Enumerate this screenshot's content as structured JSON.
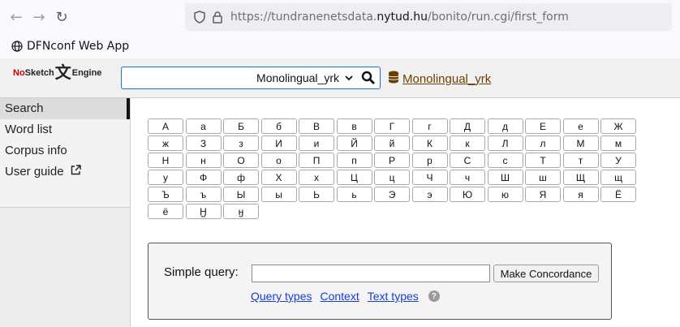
{
  "browser": {
    "url_prefix": "https://tundranenetsdata.",
    "url_host": "nytud.hu",
    "url_suffix": "/bonito/run.cgi/first_form",
    "bookmark": "DFNconf Web App"
  },
  "header": {
    "logo": {
      "no": "No",
      "sketch": "Sketch",
      "glyph": "文",
      "engine": "Engine"
    },
    "corpus_select_value": "Monolingual_yrk",
    "corpus_link": "Monolingual_yrk"
  },
  "sidebar": {
    "items": [
      {
        "label": "Search",
        "active": true
      },
      {
        "label": "Word list"
      },
      {
        "label": "Corpus info"
      },
      {
        "label": "User guide"
      }
    ]
  },
  "keyboard": {
    "keys": [
      "А",
      "а",
      "Б",
      "б",
      "В",
      "в",
      "Г",
      "г",
      "Д",
      "д",
      "Е",
      "е",
      "Ж",
      "ж",
      "З",
      "з",
      "И",
      "и",
      "Й",
      "й",
      "К",
      "к",
      "Л",
      "л",
      "М",
      "м",
      "Н",
      "н",
      "О",
      "о",
      "П",
      "п",
      "Р",
      "р",
      "С",
      "с",
      "Т",
      "т",
      "У",
      "у",
      "Ф",
      "ф",
      "Х",
      "х",
      "Ц",
      "ц",
      "Ч",
      "ч",
      "Ш",
      "ш",
      "Щ",
      "щ",
      "Ъ",
      "ъ",
      "Ы",
      "ы",
      "Ь",
      "ь",
      "Э",
      "э",
      "Ю",
      "ю",
      "Я",
      "я",
      "Ё",
      "ё",
      "Ӈ",
      "ӈ"
    ]
  },
  "query": {
    "label": "Simple query:",
    "input_value": "",
    "button": "Make Concordance",
    "links": [
      "Query types",
      "Context",
      "Text types"
    ]
  }
}
